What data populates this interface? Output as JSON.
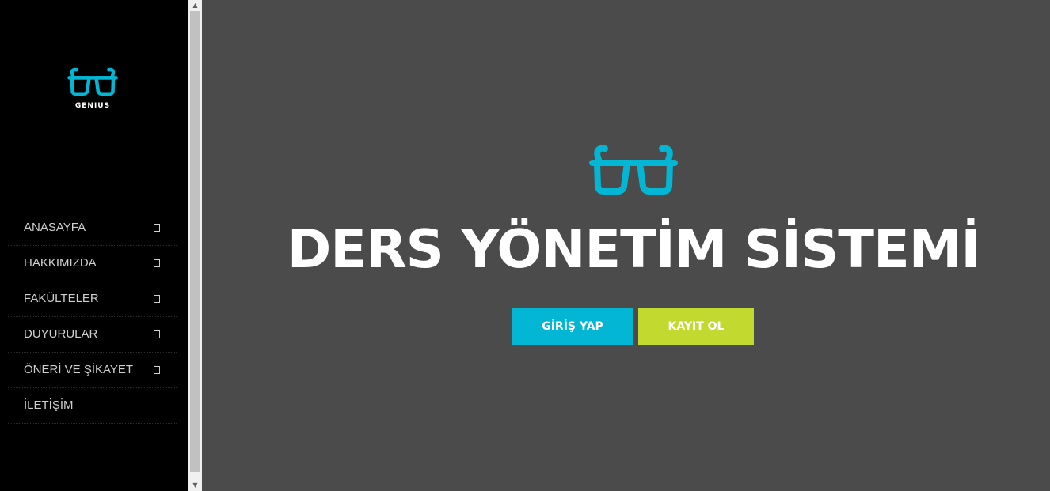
{
  "colors": {
    "sidebar_bg": "#000000",
    "main_bg": "#4b4b4b",
    "accent_cyan": "#03b6d4",
    "accent_lime": "#c2d92f",
    "nav_text": "#cfcfcf"
  },
  "sidebar": {
    "logo_icon": "glasses-icon",
    "logo_text": "GENIUS",
    "items": [
      {
        "label": "ANASAYFA",
        "has_submenu": true
      },
      {
        "label": "HAKKIMIZDA",
        "has_submenu": true
      },
      {
        "label": "FAKÜLTELER",
        "has_submenu": true
      },
      {
        "label": "DUYURULAR",
        "has_submenu": true
      },
      {
        "label": "ÖNERİ VE ŞİKAYET",
        "has_submenu": true
      },
      {
        "label": "İLETİŞİM",
        "has_submenu": false
      }
    ]
  },
  "scrollbar": {
    "up_arrow": "▲",
    "down_arrow": "▼"
  },
  "hero": {
    "icon": "glasses-icon",
    "title": "DERS YÖNETİM SİSTEMİ",
    "login_label": "GİRİŞ YAP",
    "register_label": "KAYIT OL"
  }
}
